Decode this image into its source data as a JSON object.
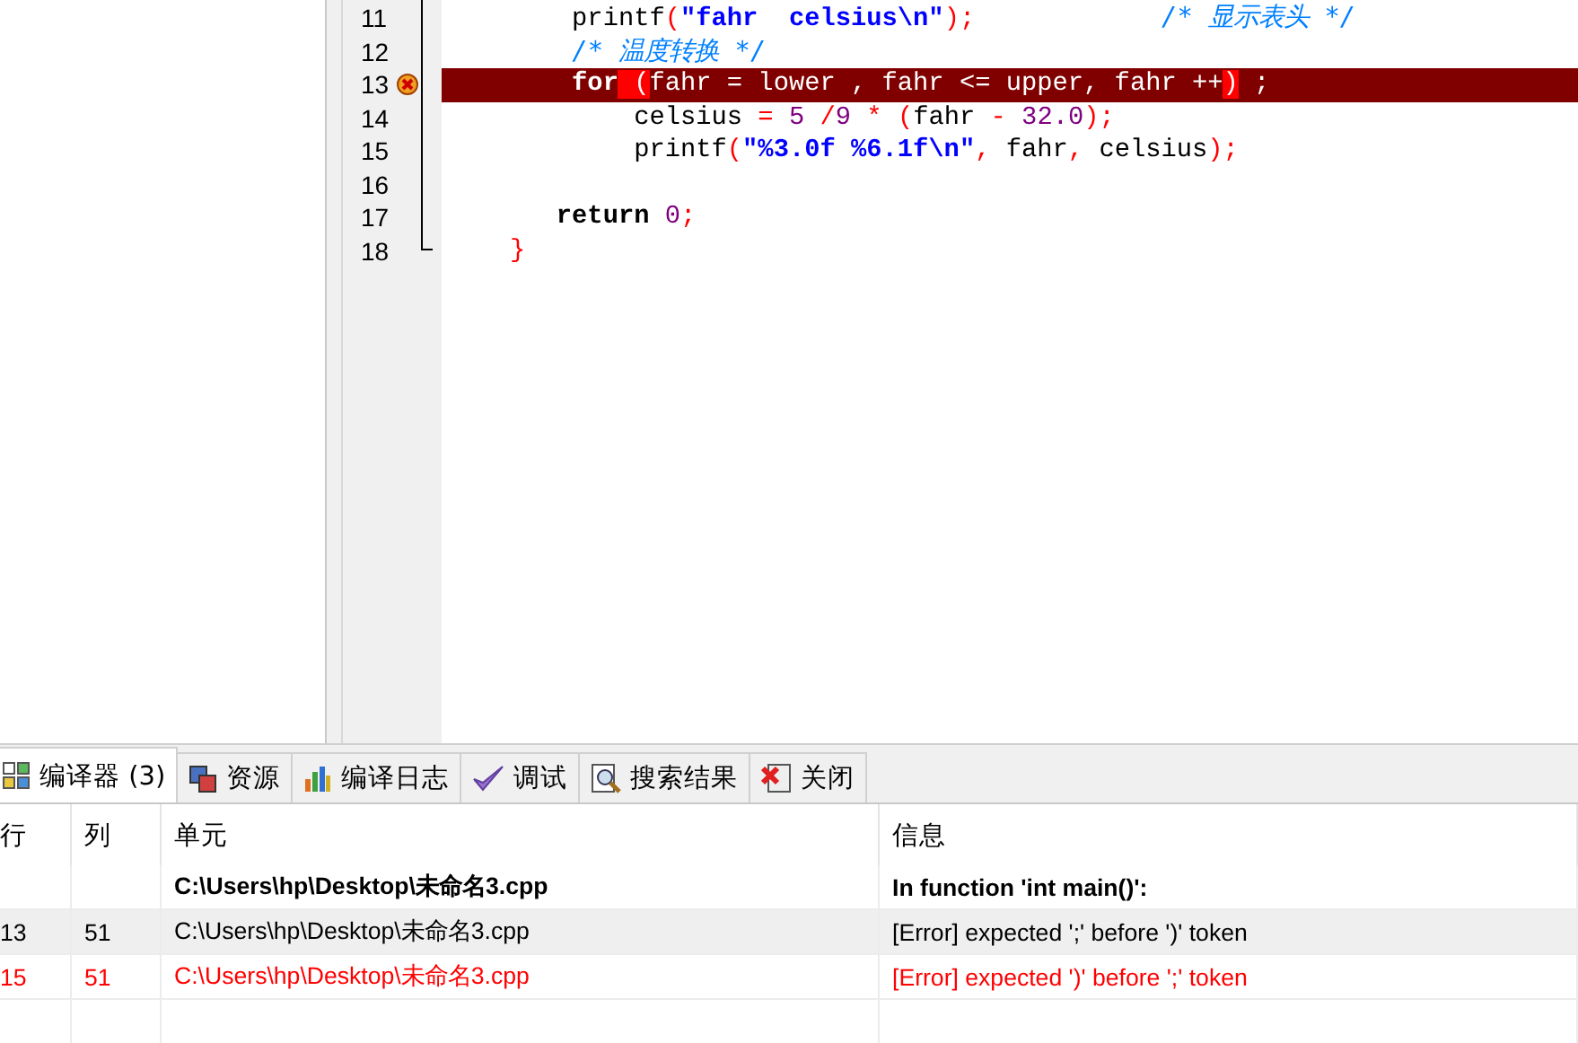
{
  "editor": {
    "lines": [
      {
        "number": "11",
        "error": false,
        "tokens": [
          {
            "kind": "plain",
            "text": "    printf"
          },
          {
            "kind": "symbol",
            "text": "("
          },
          {
            "kind": "string",
            "text": "\"fahr  celsius\\n\""
          },
          {
            "kind": "symbol",
            "text": ");"
          },
          {
            "kind": "comment",
            "text": "            /* 显示表头 */"
          }
        ]
      },
      {
        "number": "12",
        "error": false,
        "tokens": [
          {
            "kind": "comment",
            "text": "    /* 温度转换 */"
          }
        ]
      },
      {
        "number": "13",
        "error": true,
        "tokens": [
          {
            "kind": "keyword",
            "text": "    for"
          },
          {
            "kind": "match",
            "text": " ("
          },
          {
            "kind": "plain",
            "text": "fahr = lower , fahr <= upper, fahr ++"
          },
          {
            "kind": "match",
            "text": ")"
          },
          {
            "kind": "plain",
            "text": " ;"
          }
        ]
      },
      {
        "number": "14",
        "error": false,
        "tokens": [
          {
            "kind": "plain",
            "text": "        celsius"
          },
          {
            "kind": "symbol",
            "text": " ="
          },
          {
            "kind": "number",
            "text": " 5"
          },
          {
            "kind": "symbol",
            "text": " /"
          },
          {
            "kind": "number",
            "text": "9"
          },
          {
            "kind": "symbol",
            "text": " *"
          },
          {
            "kind": "symbol",
            "text": " ("
          },
          {
            "kind": "plain",
            "text": "fahr"
          },
          {
            "kind": "symbol",
            "text": " -"
          },
          {
            "kind": "number",
            "text": " 32.0"
          },
          {
            "kind": "symbol",
            "text": ");"
          }
        ]
      },
      {
        "number": "15",
        "error": false,
        "tokens": [
          {
            "kind": "plain",
            "text": "        printf"
          },
          {
            "kind": "symbol",
            "text": "("
          },
          {
            "kind": "string",
            "text": "\"%3.0f %6.1f\\n\""
          },
          {
            "kind": "symbol",
            "text": ","
          },
          {
            "kind": "plain",
            "text": " fahr"
          },
          {
            "kind": "symbol",
            "text": ","
          },
          {
            "kind": "plain",
            "text": " celsius"
          },
          {
            "kind": "symbol",
            "text": ");"
          }
        ]
      },
      {
        "number": "16",
        "error": false
      },
      {
        "number": "17",
        "error": false,
        "tokens": [
          {
            "kind": "keyword",
            "text": "   return"
          },
          {
            "kind": "number",
            "text": " 0"
          },
          {
            "kind": "symbol",
            "text": ";"
          }
        ]
      },
      {
        "number": "18",
        "error": false,
        "tokens": [
          {
            "kind": "symbol",
            "text": "}"
          }
        ]
      }
    ]
  },
  "tabs": [
    {
      "label": "编译器 (3)",
      "selected": true
    },
    {
      "label": "资源",
      "selected": false
    },
    {
      "label": "编译日志",
      "selected": false
    },
    {
      "label": "调试",
      "selected": false
    },
    {
      "label": "搜索结果",
      "selected": false
    },
    {
      "label": "关闭",
      "selected": false
    }
  ],
  "table": {
    "columns": [
      "行",
      "列",
      "单元",
      "信息"
    ],
    "rows": [
      {
        "cells": [
          "",
          "",
          "C:\\Users\\hp\\Desktop\\未命名3.cpp",
          "In function 'int main()':"
        ],
        "bold": true,
        "selected": false,
        "color": "#000000"
      },
      {
        "cells": [
          "13",
          "51",
          "C:\\Users\\hp\\Desktop\\未命名3.cpp",
          "[Error] expected ';' before ')' token"
        ],
        "bold": false,
        "selected": true,
        "color": "#000000"
      },
      {
        "cells": [
          "15",
          "51",
          "C:\\Users\\hp\\Desktop\\未命名3.cpp",
          "[Error] expected ')' before ';' token"
        ],
        "bold": false,
        "selected": false,
        "color": "#ff0000"
      }
    ]
  }
}
